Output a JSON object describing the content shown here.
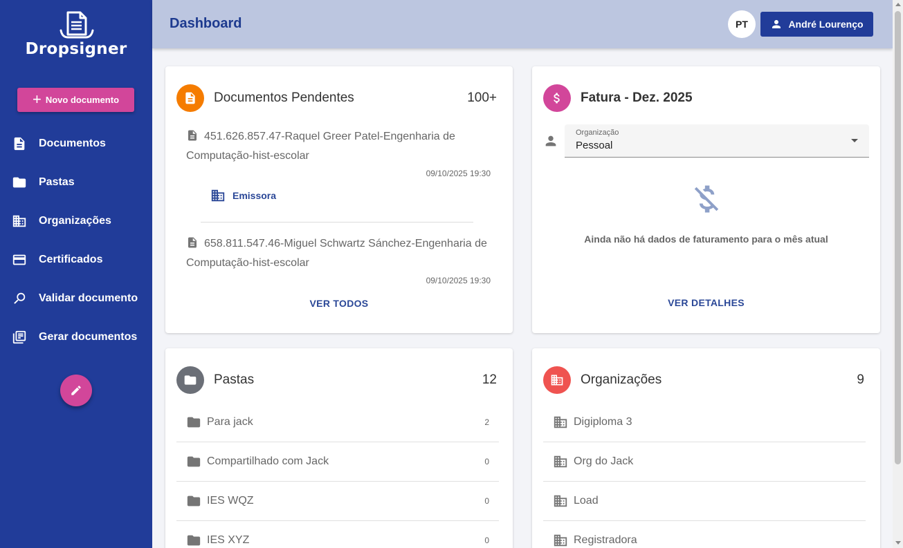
{
  "app": {
    "logo_text": "Dropsigner",
    "new_document_label": "Novo documento"
  },
  "sidebar": {
    "items": [
      {
        "label": "Documentos"
      },
      {
        "label": "Pastas"
      },
      {
        "label": "Organizações"
      },
      {
        "label": "Certificados"
      },
      {
        "label": "Validar documento"
      },
      {
        "label": "Gerar documentos"
      }
    ]
  },
  "header": {
    "title": "Dashboard",
    "language": "PT",
    "user_name": "André Lourenço"
  },
  "pending": {
    "title": "Documentos Pendentes",
    "count": "100+",
    "action": "VER TODOS",
    "items": [
      {
        "title": "451.626.857.47-Raquel Greer Patel-Engenharia de Computação-hist-escolar",
        "date": "09/10/2025 19:30",
        "org": "Emissora"
      },
      {
        "title": "658.811.547.46-Miguel Schwartz Sánchez-Engenharia de Computação-hist-escolar",
        "date": "09/10/2025 19:30"
      }
    ]
  },
  "invoice": {
    "title": "Fatura - Dez. 2025",
    "select_label": "Organização",
    "select_value": "Pessoal",
    "empty_text": "Ainda não há dados de faturamento para o mês atual",
    "action": "VER DETALHES"
  },
  "folders": {
    "title": "Pastas",
    "count": "12",
    "items": [
      {
        "label": "Para jack",
        "count": "2"
      },
      {
        "label": "Compartilhado com Jack",
        "count": "0"
      },
      {
        "label": "IES WQZ",
        "count": "0"
      },
      {
        "label": "IES XYZ",
        "count": "0"
      }
    ]
  },
  "organizations": {
    "title": "Organizações",
    "count": "9",
    "items": [
      {
        "label": "Digiploma 3"
      },
      {
        "label": "Org do Jack"
      },
      {
        "label": "Load"
      },
      {
        "label": "Registradora"
      }
    ]
  },
  "colors": {
    "sidebar": "#213c99",
    "accent": "#d2469a",
    "header": "#bcc6e0",
    "pending_avatar": "#f57c00",
    "invoice_avatar": "#d2469a",
    "folders_avatar": "#6b6f77",
    "orgs_avatar": "#ef5350"
  }
}
